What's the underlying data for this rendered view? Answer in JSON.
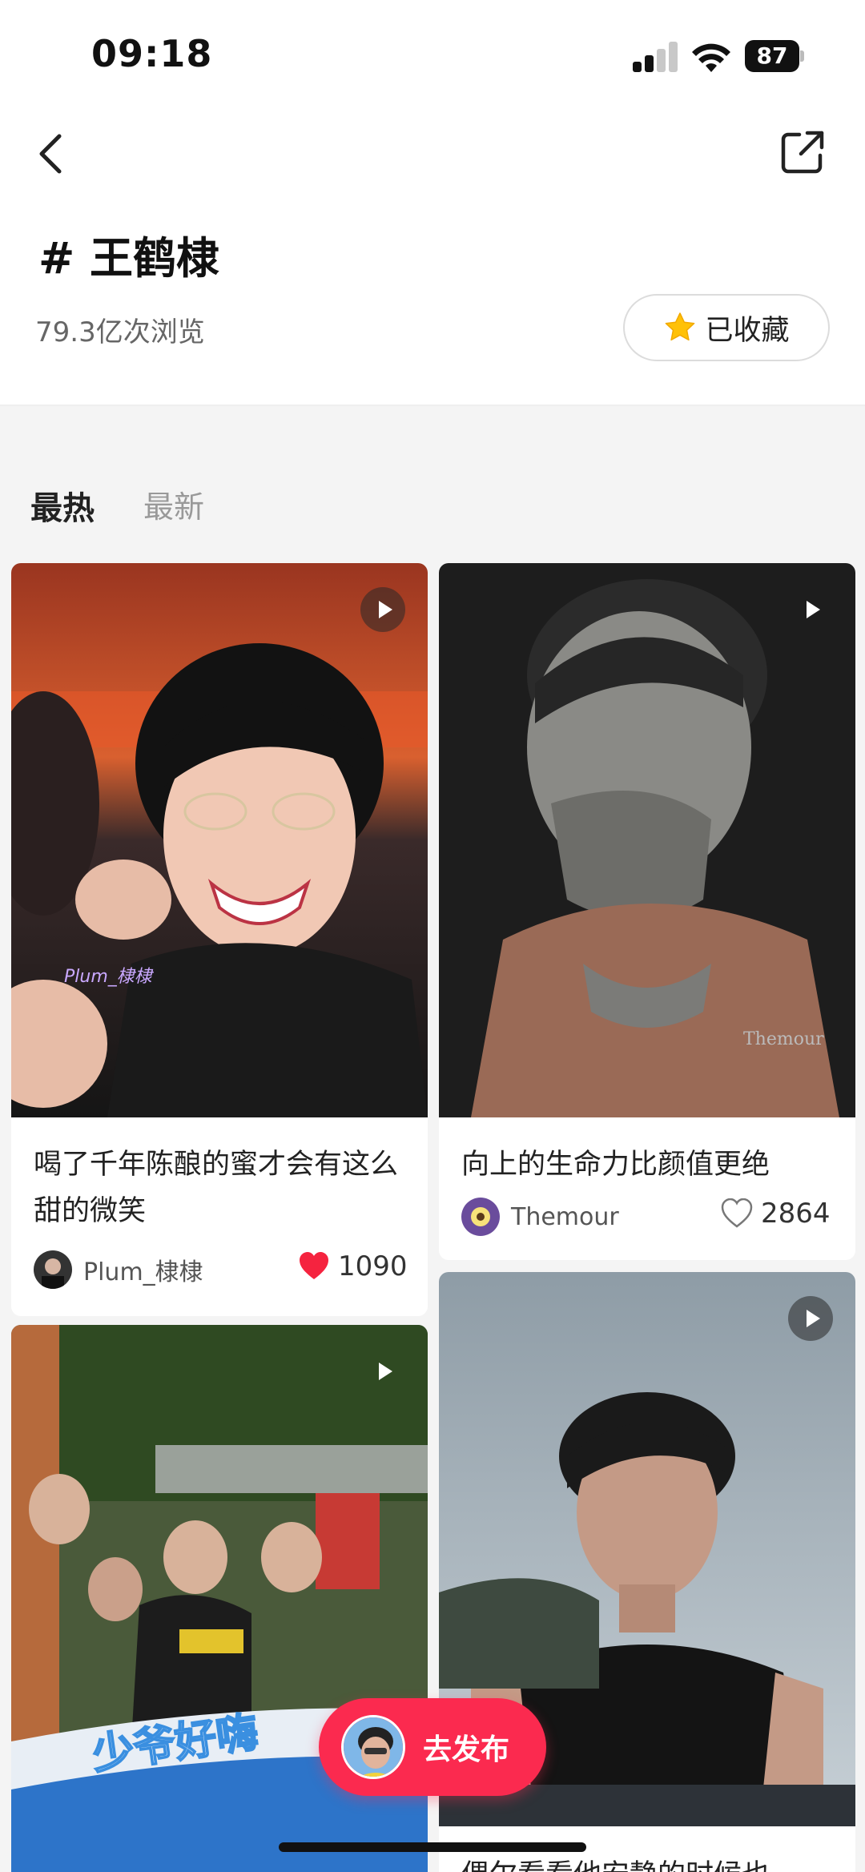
{
  "status_bar": {
    "time": "09:18",
    "battery": "87"
  },
  "header": {
    "back_icon": "chevron-left-icon",
    "share_icon": "share-external-icon",
    "topic_title": "# 王鹤棣",
    "views": "79.3亿次浏览",
    "favorite_label": "已收藏",
    "favorite_icon": "star-icon",
    "favorite_color": "#ffc107"
  },
  "tabs": [
    {
      "label": "最热",
      "active": true
    },
    {
      "label": "最新",
      "active": false
    }
  ],
  "feed": {
    "cards": [
      {
        "title": "喝了千年陈酿的蜜才会有这么甜的微笑",
        "author": "Plum_棣棣",
        "likes": "1090",
        "liked": true,
        "is_video": true,
        "watermark": "Plum_棣棣"
      },
      {
        "title": "向上的生命力比颜值更绝",
        "author": "Themour",
        "likes": "2864",
        "liked": false,
        "is_video": true,
        "watermark": "Themour"
      },
      {
        "title": "",
        "is_video": true,
        "overlay_text": "少爷好嗨"
      },
      {
        "title": "偶尔看看他安静的时候也",
        "is_video": true
      }
    ]
  },
  "publish_button": {
    "label": "去发布"
  },
  "colors": {
    "accent": "#fb2a4f",
    "like_red": "#f5233f",
    "star_yellow": "#ffc107"
  }
}
